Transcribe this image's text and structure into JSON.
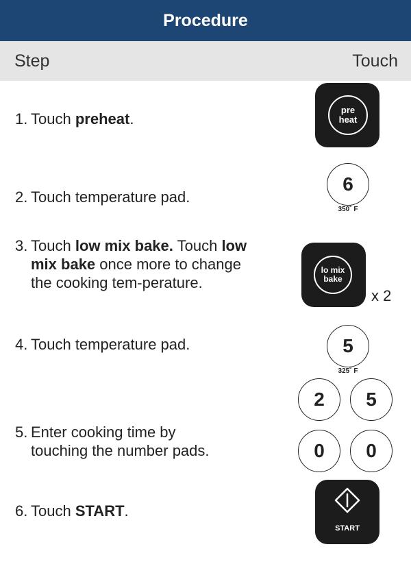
{
  "header": {
    "title": "Procedure"
  },
  "columns": {
    "step": "Step",
    "touch": "Touch"
  },
  "steps": [
    {
      "num": "1.",
      "text_before": "Touch ",
      "bold": "preheat",
      "text_after": "."
    },
    {
      "num": "2.",
      "text": "Touch temperature pad."
    },
    {
      "num": "3.",
      "part1": "Touch ",
      "bold1": "low mix bake.",
      "part2": " Touch ",
      "bold2": "low mix bake",
      "part3": " once more to change the cooking tem-perature."
    },
    {
      "num": "4.",
      "text": "Touch temperature pad."
    },
    {
      "num": "5.",
      "text": "Enter cooking time by touching the number pads."
    },
    {
      "num": "6.",
      "text_before": "Touch ",
      "bold": "START",
      "text_after": "."
    }
  ],
  "keys": {
    "preheat": {
      "line1": "pre",
      "line2": "heat"
    },
    "temp_6": {
      "digit": "6",
      "label": "350˚ F"
    },
    "low_mix_bake": {
      "line1": "lo mix",
      "line2": "bake",
      "multiplier": "x 2"
    },
    "temp_5": {
      "digit": "5",
      "label": "325˚ F"
    },
    "time_pads": [
      "2",
      "5",
      "0",
      "0"
    ],
    "start": {
      "label": "START"
    }
  },
  "colors": {
    "header_bg": "#1e4675",
    "subheader_bg": "#e5e5e5",
    "key_bg": "#1c1c1c"
  }
}
